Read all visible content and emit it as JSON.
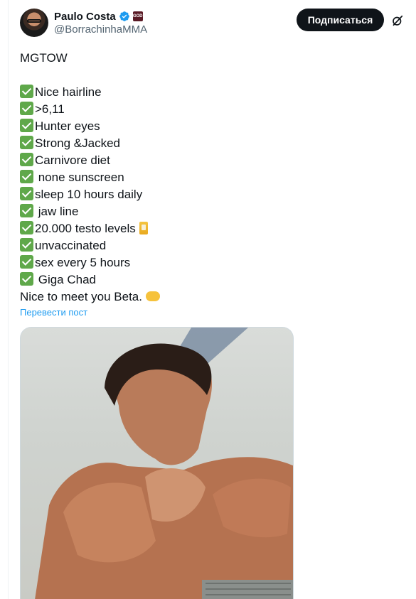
{
  "author": {
    "display_name": "Paulo Costa",
    "handle": "@BorrachinhaMMA",
    "badge_text": "GOD"
  },
  "actions": {
    "subscribe_label": "Подписаться"
  },
  "tweet": {
    "lines": [
      {
        "check": false,
        "text": "MGTOW"
      },
      {
        "check": false,
        "text": ""
      },
      {
        "check": true,
        "text": "Nice hairline"
      },
      {
        "check": true,
        "text": ">6,11"
      },
      {
        "check": true,
        "text": "Hunter eyes"
      },
      {
        "check": true,
        "text": "Strong &Jacked"
      },
      {
        "check": true,
        "text": "Carnivore diet"
      },
      {
        "check": true,
        "text": " none sunscreen"
      },
      {
        "check": true,
        "text": "sleep 10 hours daily"
      },
      {
        "check": true,
        "text": " jaw line"
      },
      {
        "check": true,
        "text": "20.000 testo levels"
      },
      {
        "check": true,
        "text": "unvaccinated"
      },
      {
        "check": true,
        "text": "sex every 5 hours"
      },
      {
        "check": true,
        "text": " Giga Chad"
      },
      {
        "check": false,
        "text": "Nice to meet you Beta."
      }
    ],
    "translate_label": "Перевести пост"
  },
  "icons": {
    "verified": "verified-badge-icon",
    "grok": "grok-icon",
    "check": "check-mark-emoji-icon",
    "can": "beverage-can-emoji-icon",
    "handshake": "handshake-emoji-icon"
  },
  "colors": {
    "accent": "#1d9bf0",
    "text": "#0f1419",
    "muted": "#536471",
    "button_bg": "#0f1419",
    "check_green": "#5fa84a"
  }
}
